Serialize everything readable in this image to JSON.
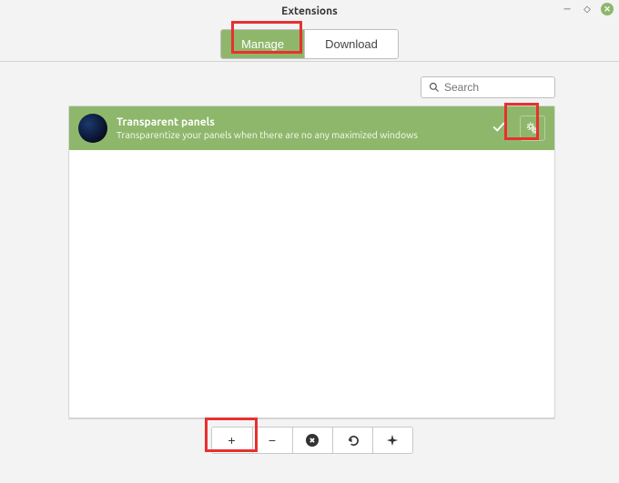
{
  "window": {
    "title": "Extensions"
  },
  "tabs": {
    "manage": "Manage",
    "download": "Download"
  },
  "search": {
    "placeholder": "Search"
  },
  "extension": {
    "title": "Transparent panels",
    "description": "Transparentize your panels when there are no any maximized windows"
  },
  "toolbar": {
    "add": "+",
    "remove": "−",
    "delete": "✖",
    "undo": "↺",
    "more": "✦"
  }
}
